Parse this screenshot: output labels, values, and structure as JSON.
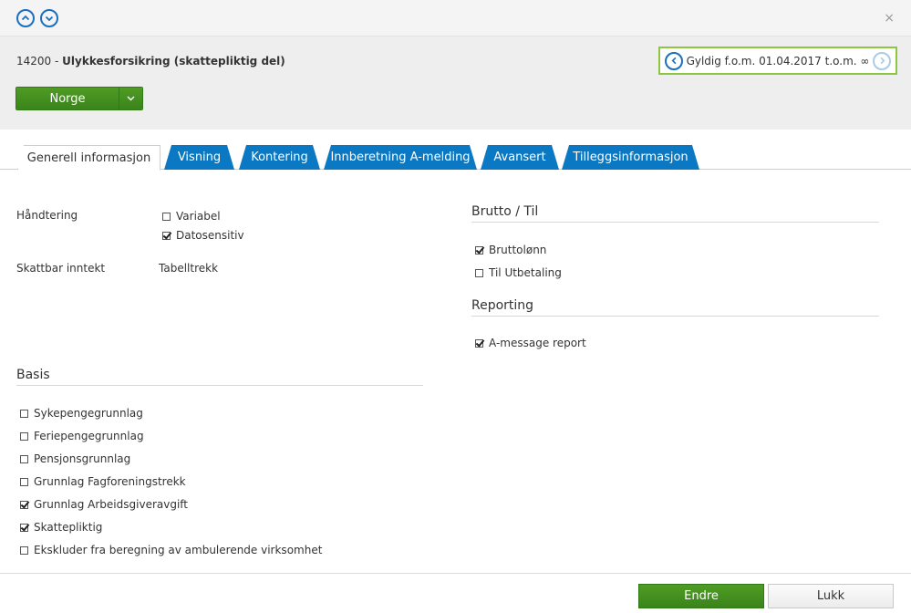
{
  "header": {
    "record_code": "14200",
    "record_separator": " - ",
    "record_name": "Ulykkesforsikring (skattepliktig del)",
    "validity_text": "Gyldig f.o.m. 01.04.2017 t.o.m. ∞",
    "country_button": "Norge",
    "close_symbol": "×"
  },
  "tabs": [
    {
      "label": "Generell informasjon",
      "active": true
    },
    {
      "label": "Visning",
      "active": false
    },
    {
      "label": "Kontering",
      "active": false
    },
    {
      "label": "Innberetning A-melding",
      "active": false
    },
    {
      "label": "Avansert",
      "active": false
    },
    {
      "label": "Tilleggsinformasjon",
      "active": false
    }
  ],
  "general": {
    "handling_label": "Håndtering",
    "handling_options": [
      {
        "label": "Variabel",
        "checked": false
      },
      {
        "label": "Datosensitiv",
        "checked": true
      }
    ],
    "taxable_income_label": "Skattbar inntekt",
    "taxable_income_value": "Tabelltrekk"
  },
  "basis": {
    "title": "Basis",
    "options": [
      {
        "label": "Sykepengegrunnlag",
        "checked": false
      },
      {
        "label": "Feriepengegrunnlag",
        "checked": false
      },
      {
        "label": "Pensjonsgrunnlag",
        "checked": false
      },
      {
        "label": "Grunnlag Fagforeningstrekk",
        "checked": false
      },
      {
        "label": "Grunnlag Arbeidsgiveravgift",
        "checked": true
      },
      {
        "label": "Skattepliktig",
        "checked": true
      },
      {
        "label": "Ekskluder fra beregning av ambulerende virksomhet",
        "checked": false
      }
    ]
  },
  "gross": {
    "title": "Brutto / Til",
    "options": [
      {
        "label": "Bruttolønn",
        "checked": true
      },
      {
        "label": "Til Utbetaling",
        "checked": false
      }
    ]
  },
  "reporting": {
    "title": "Reporting",
    "options": [
      {
        "label": "A-message report",
        "checked": true
      }
    ]
  },
  "footer": {
    "primary_label": "Endre",
    "secondary_label": "Lukk"
  },
  "colors": {
    "accent_blue": "#0a78c2",
    "primary_green": "#3a841b",
    "validity_border": "#8dc63f"
  }
}
